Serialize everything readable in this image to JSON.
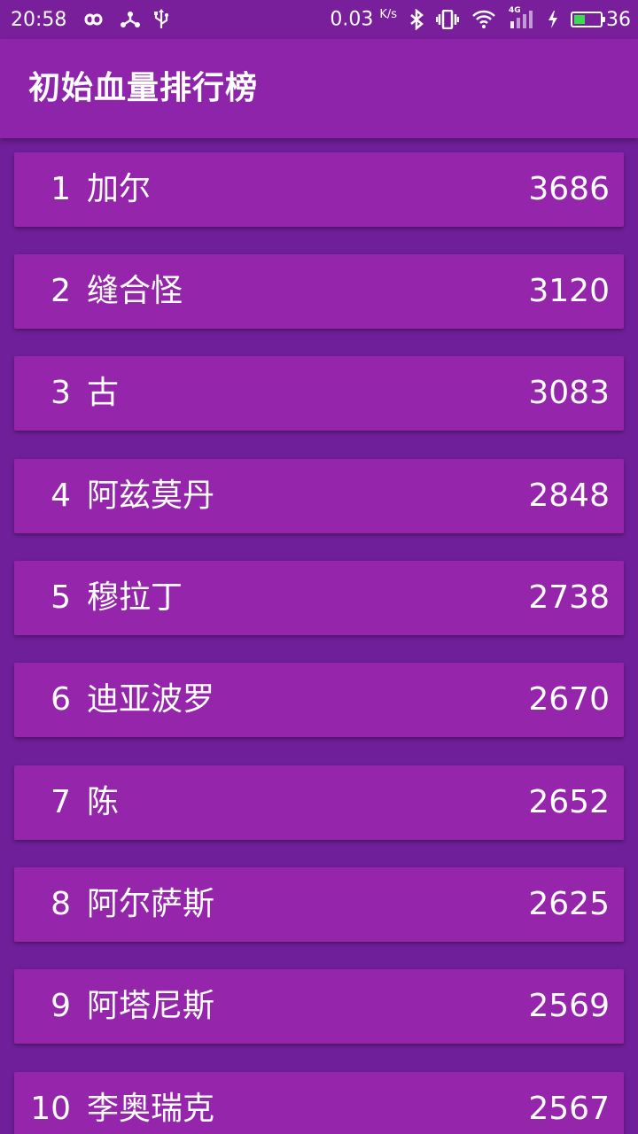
{
  "status_bar": {
    "time": "20:58",
    "net_speed": "0.03",
    "net_unit": "K/s",
    "signal_label": "4G",
    "battery_level": "36",
    "icons": [
      "infinity-icon",
      "usb-network-icon",
      "usb-icon",
      "bluetooth-icon",
      "vibrate-icon",
      "wifi-icon",
      "signal-icon",
      "charging-icon",
      "battery-icon"
    ]
  },
  "app_bar": {
    "title": "初始血量排行榜"
  },
  "colors": {
    "background": "#6f1f99",
    "app_bar": "#8e24aa",
    "card": "#9526ab",
    "status_bar": "#7a1f9c",
    "battery_fill": "#3ddc4d"
  },
  "ranking": [
    {
      "rank": "1",
      "name": "加尔",
      "hp": "3686"
    },
    {
      "rank": "2",
      "name": "缝合怪",
      "hp": "3120"
    },
    {
      "rank": "3",
      "name": "古",
      "hp": "3083"
    },
    {
      "rank": "4",
      "name": "阿兹莫丹",
      "hp": "2848"
    },
    {
      "rank": "5",
      "name": "穆拉丁",
      "hp": "2738"
    },
    {
      "rank": "6",
      "name": "迪亚波罗",
      "hp": "2670"
    },
    {
      "rank": "7",
      "name": "陈",
      "hp": "2652"
    },
    {
      "rank": "8",
      "name": "阿尔萨斯",
      "hp": "2625"
    },
    {
      "rank": "9",
      "name": "阿塔尼斯",
      "hp": "2569"
    },
    {
      "rank": "10",
      "name": "李奥瑞克",
      "hp": "2567"
    }
  ]
}
